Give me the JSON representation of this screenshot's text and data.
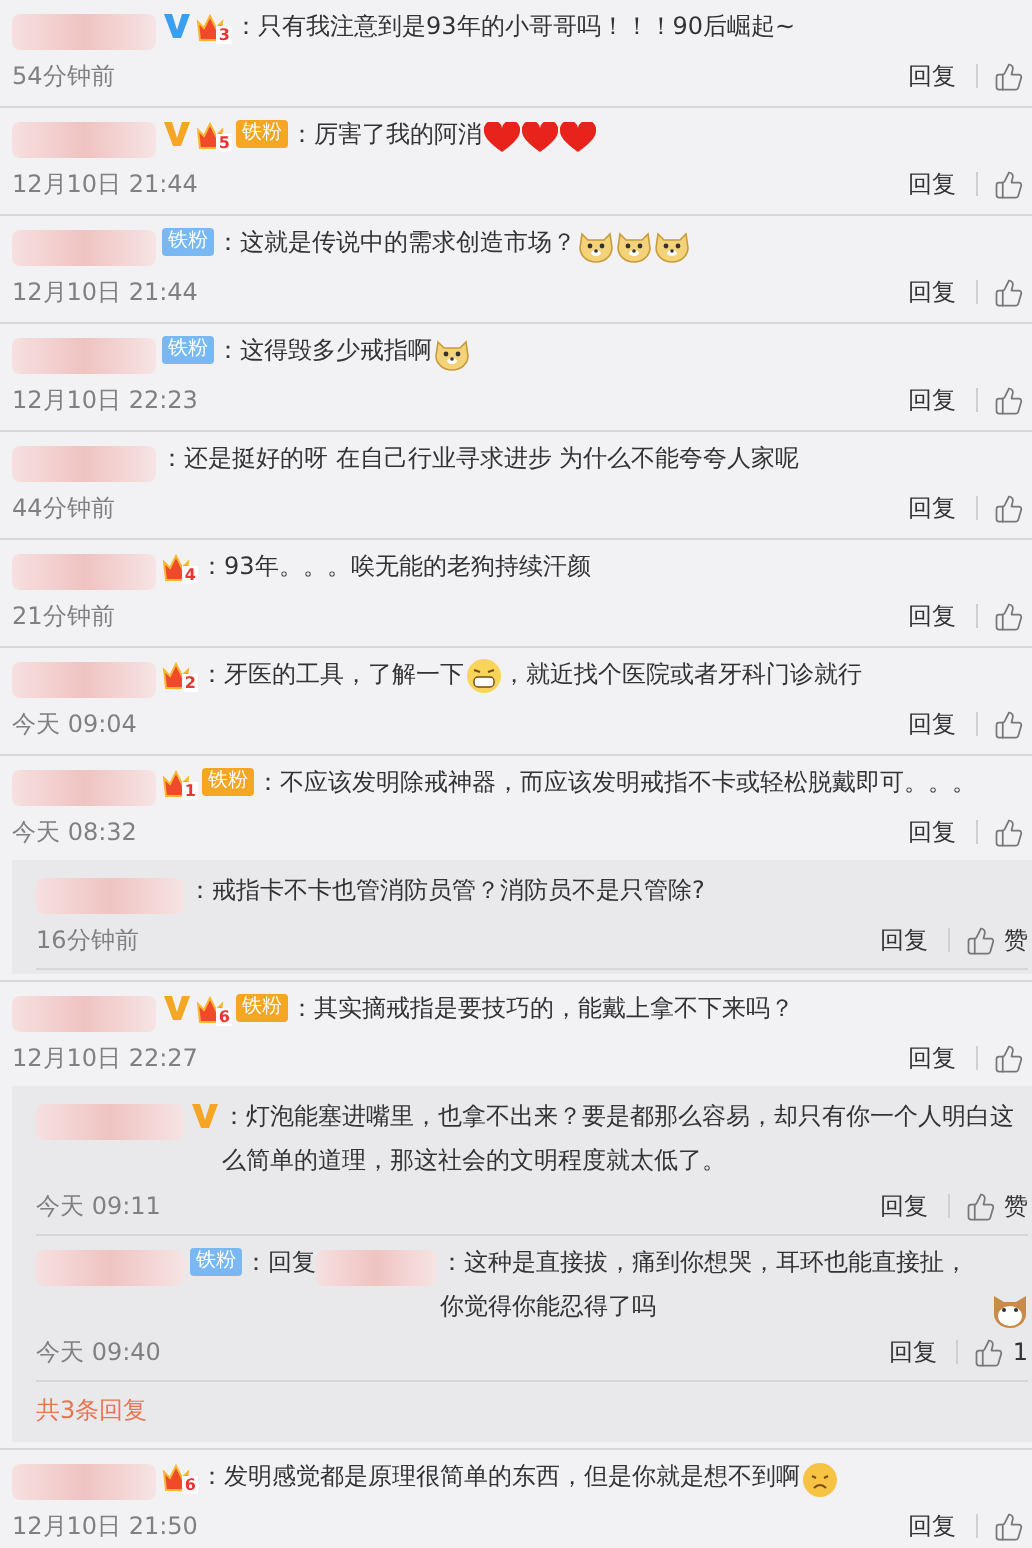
{
  "comments": [
    {
      "verified": {
        "color": "#3a9ff0"
      },
      "crown": "3",
      "parts": [
        {
          "kind": "text",
          "text": "：只有我注意到是93年的小哥哥吗！！！90后崛起~"
        }
      ],
      "time": "54分钟前",
      "reply": "回复"
    },
    {
      "verified": {
        "color": "#f5a623"
      },
      "crown": "5",
      "fan": {
        "label": "铁粉",
        "color": "#f5a623"
      },
      "parts": [
        {
          "kind": "text",
          "text": "：厉害了我的阿消"
        },
        {
          "kind": "heart"
        },
        {
          "kind": "heart"
        },
        {
          "kind": "heart"
        }
      ],
      "time": "12月10日 21:44",
      "reply": "回复"
    },
    {
      "fan": {
        "label": "铁粉",
        "color": "#79b8f2"
      },
      "parts": [
        {
          "kind": "text",
          "text": "：这就是传说中的需求创造市场？"
        },
        {
          "kind": "dog"
        },
        {
          "kind": "dog"
        },
        {
          "kind": "dog"
        }
      ],
      "time": "12月10日 21:44",
      "reply": "回复"
    },
    {
      "fan": {
        "label": "铁粉",
        "color": "#79b8f2"
      },
      "parts": [
        {
          "kind": "text",
          "text": "：这得毁多少戒指啊"
        },
        {
          "kind": "dog"
        }
      ],
      "time": "12月10日 22:23",
      "reply": "回复"
    },
    {
      "parts": [
        {
          "kind": "text",
          "text": "：还是挺好的呀 在自己行业寻求进步 为什么不能夸夸人家呢"
        }
      ],
      "time": "44分钟前",
      "reply": "回复"
    },
    {
      "crown": "4",
      "parts": [
        {
          "kind": "text",
          "text": "：93年。。。唉无能的老狗持续汗颜"
        }
      ],
      "time": "21分钟前",
      "reply": "回复"
    },
    {
      "crown": "2",
      "parts": [
        {
          "kind": "text",
          "text": "：牙医的工具，了解一下"
        },
        {
          "kind": "grin"
        },
        {
          "kind": "text",
          "text": "，就近找个医院或者牙科门诊就行"
        }
      ],
      "time": "今天 09:04",
      "reply": "回复"
    },
    {
      "crown": "1",
      "fan": {
        "label": "铁粉",
        "color": "#f5a623"
      },
      "parts": [
        {
          "kind": "text",
          "text": "：不应该发明除戒神器，而应该发明戒指不卡或轻松脱戴即可。。。"
        }
      ],
      "time": "今天 08:32",
      "reply": "回复",
      "replies": [
        {
          "parts": [
            {
              "kind": "text",
              "text": "：戒指卡不卡也管消防员管？消防员不是只管除?"
            }
          ],
          "time": "16分钟前",
          "reply": "回复",
          "like": "赞"
        }
      ]
    },
    {
      "verified": {
        "color": "#f5a623"
      },
      "crown": "6",
      "fan": {
        "label": "铁粉",
        "color": "#f5a623"
      },
      "parts": [
        {
          "kind": "text",
          "text": "：其实摘戒指是要技巧的，能戴上拿不下来吗？"
        }
      ],
      "time": "12月10日 22:27",
      "reply": "回复",
      "replies": [
        {
          "verified": {
            "color": "#f5a623"
          },
          "parts": [
            {
              "kind": "text",
              "text": "：灯泡能塞进嘴里，也拿不出来？要是都那么容易，却只有你一个人明白这么简单的道理，那这社会的文明程度就太低了。"
            }
          ],
          "time": "今天 09:11",
          "reply": "回复",
          "like": "赞"
        },
        {
          "fan": {
            "label": "铁粉",
            "color": "#79b8f2"
          },
          "parts": [
            {
              "kind": "text",
              "text": "：回复"
            },
            {
              "kind": "redacted"
            },
            {
              "kind": "text",
              "text": "：这种是直接拔，痛到你想哭，耳环也能直接扯，你觉得你能忍得了吗"
            },
            {
              "kind": "cat"
            }
          ],
          "time": "今天 09:40",
          "reply": "回复",
          "like": "1"
        }
      ],
      "more": "共3条回复"
    },
    {
      "crown": "6",
      "parts": [
        {
          "kind": "text",
          "text": "：发明感觉都是原理很简单的东西，但是你就是想不到啊"
        },
        {
          "kind": "sad"
        }
      ],
      "time": "12月10日 21:50",
      "reply": "回复"
    }
  ]
}
